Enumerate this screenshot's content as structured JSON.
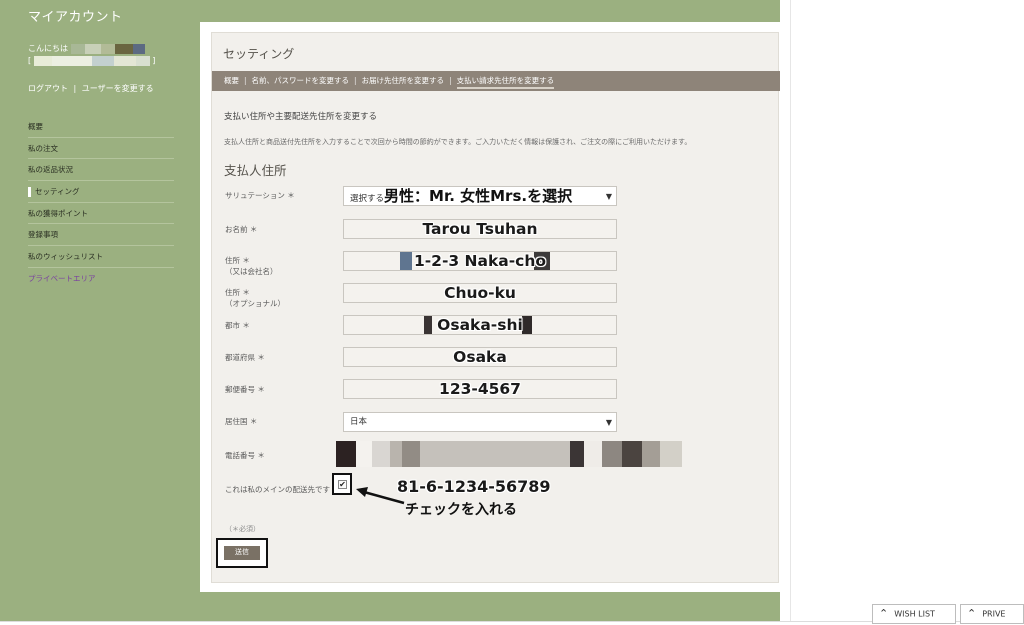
{
  "sidebar": {
    "title": "マイアカウント",
    "greeting": "こんにちは",
    "logout": "ログアウト",
    "switch_user": "ユーザーを変更する",
    "separator": "|",
    "bracket_open": "[",
    "bracket_close": "]",
    "items": [
      {
        "label": "概要"
      },
      {
        "label": "私の注文"
      },
      {
        "label": "私の返品状況"
      },
      {
        "label": "セッティング"
      },
      {
        "label": "私の獲得ポイント"
      },
      {
        "label": "登録事項"
      },
      {
        "label": "私のウィッシュリスト"
      },
      {
        "label": "プライベートエリア"
      }
    ]
  },
  "panel": {
    "title": "セッティング",
    "tabs": [
      {
        "label": "概要"
      },
      {
        "label": "名前、パスワードを変更する"
      },
      {
        "label": "お届け先住所を変更する"
      },
      {
        "label": "支払い請求先住所を変更する"
      }
    ],
    "tab_separator": "|",
    "heading": "支払い住所や主要配送先住所を変更する",
    "description": "支払人住所と商品送付先住所を入力することで次回から時間の節約ができます。ご入力いただく情報は保護され、ご注文の際にご利用いただけます。",
    "section_title": "支払人住所"
  },
  "form": {
    "salutation": {
      "label": "サリュテーション ＊",
      "select_prefix": "選択する",
      "annotation": "男性：Mr. 女性Mrs.を選択"
    },
    "name": {
      "label": "お名前 ＊",
      "value": "Tarou Tsuhan"
    },
    "address1": {
      "label": "住所 ＊",
      "sublabel": "（又は会社名）",
      "value": "1-2-3 Naka-cho"
    },
    "address2": {
      "label": "住所 ＊",
      "sublabel": "（オプショナル）",
      "value": "Chuo-ku"
    },
    "city": {
      "label": "都市 ＊",
      "value": "Osaka-shi"
    },
    "prefecture": {
      "label": "都道府県 ＊",
      "value": "Osaka"
    },
    "postal": {
      "label": "郵便番号 ＊",
      "value": "123-4567"
    },
    "country": {
      "label": "居住国 ＊",
      "value": "日本"
    },
    "phone": {
      "label": "電話番号 ＊",
      "value": "81-6-1234-56789"
    },
    "main_address_label": "これは私のメインの配送先です",
    "main_address_checked": true,
    "check_annotation": "チェックを入れる",
    "required_note": "（＊必須）",
    "submit_label": "送信"
  },
  "bottom_bar": {
    "wishlist": "WISH LIST",
    "private": "PRIVE"
  },
  "colors": {
    "background_green": "#9bb080",
    "tabbar": "#8e8479",
    "panel": "#f2f0ec",
    "private_link": "#7a3fa0"
  }
}
